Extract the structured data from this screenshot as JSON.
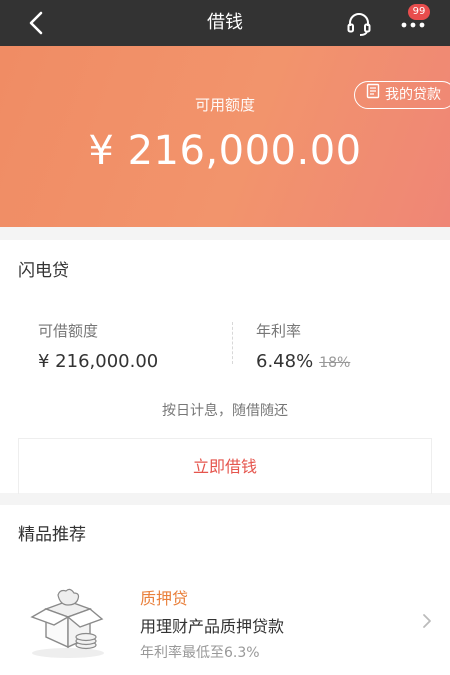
{
  "nav": {
    "title": "借钱",
    "badge": "99"
  },
  "hero": {
    "label": "可用额度",
    "amount": "¥ 216,000.00",
    "my_loans": "我的贷款"
  },
  "flash_loan": {
    "title": "闪电贷",
    "available_label": "可借额度",
    "available_value": "¥ 216,000.00",
    "rate_label": "年利率",
    "rate_value": "6.48%",
    "rate_original": "18%",
    "note": "按日计息，随借随还",
    "button": "立即借钱"
  },
  "recommend": {
    "title": "精品推荐",
    "product_title": "质押贷",
    "product_desc": "用理财产品质押贷款",
    "product_rate": "年利率最低至6.3%"
  },
  "icons": {
    "back": "back-arrow-icon",
    "support": "headset-icon",
    "more": "more-icon",
    "doc": "document-icon",
    "chevron": "chevron-right-icon"
  }
}
